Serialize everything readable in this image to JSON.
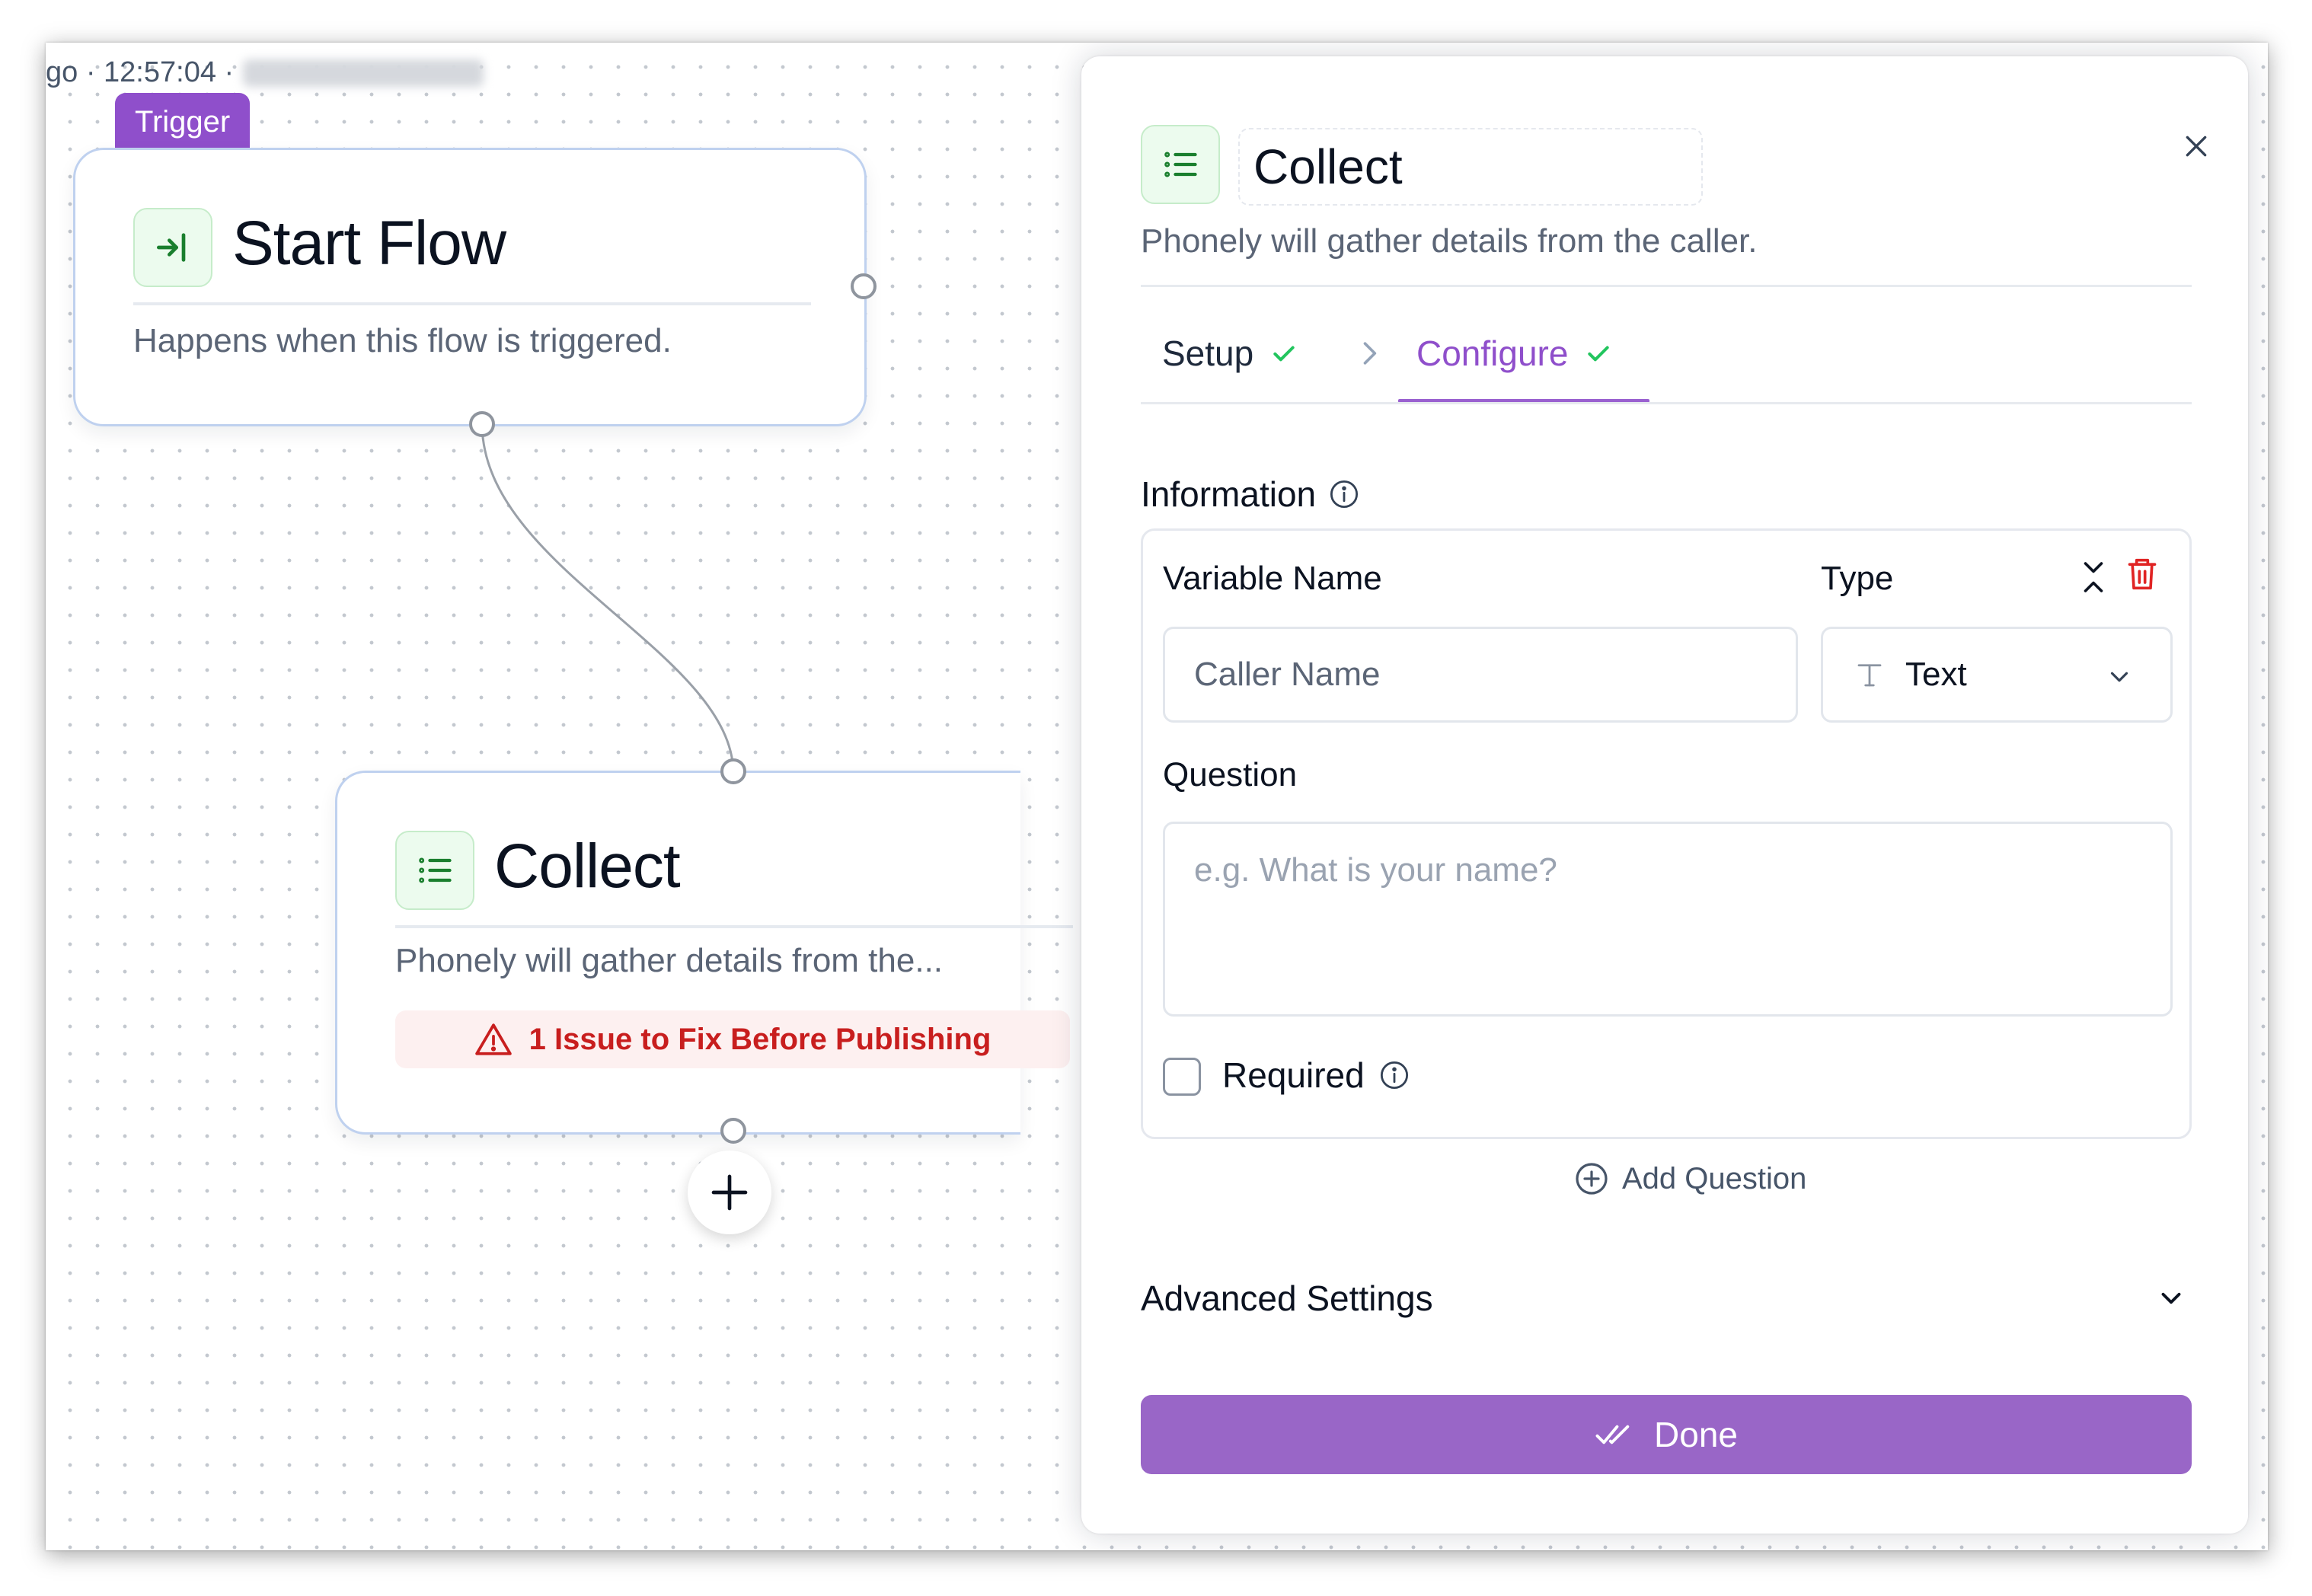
{
  "canvas": {
    "meta_prefix": "go · 12:57:04 ·",
    "trigger_tag": "Trigger",
    "start_node": {
      "title": "Start Flow",
      "description": "Happens when this flow is triggered.",
      "icon": "enter-icon"
    },
    "collect_node": {
      "title": "Collect",
      "description": "Phonely will gather details from the...",
      "issue": "1 Issue to Fix Before Publishing",
      "icon": "list-icon"
    },
    "add_node_icon": "plus-icon"
  },
  "panel": {
    "title": "Collect",
    "description": "Phonely will gather details from the caller.",
    "tabs": [
      {
        "label": "Setup",
        "complete": true
      },
      {
        "label": "Configure",
        "complete": true,
        "active": true
      }
    ],
    "information_label": "Information",
    "question_card": {
      "variable_name_label": "Variable Name",
      "variable_name_value": "Caller Name",
      "type_label": "Type",
      "type_value": "Text",
      "question_label": "Question",
      "question_placeholder": "e.g. What is your name?",
      "required_label": "Required",
      "required_checked": false
    },
    "add_question_label": "Add Question",
    "advanced_settings_label": "Advanced Settings",
    "done_label": "Done"
  },
  "colors": {
    "accent": "#9966c7",
    "trigger_tag": "#8f4fcb",
    "success": "#22c55e",
    "danger": "#c81e1e",
    "node_border": "#bfd1ef"
  }
}
